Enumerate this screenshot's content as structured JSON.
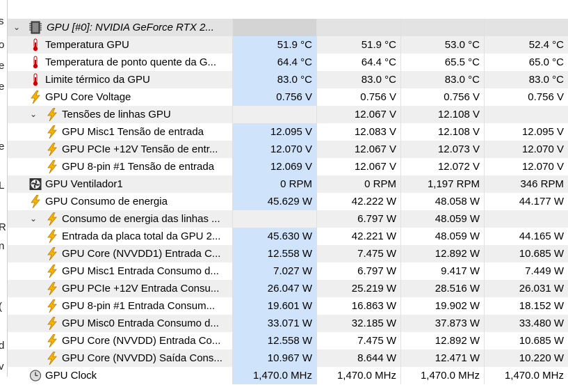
{
  "left_strip": [
    "s",
    "o",
    "e",
    "e",
    "",
    "e",
    "",
    "L",
    "R",
    "n",
    "(",
    "d",
    "v"
  ],
  "header_group": {
    "label": "GPU [#0]: NVIDIA GeForce RTX 2...",
    "icon": "gpu-chip-icon",
    "expand": "⌄"
  },
  "colors": {
    "highlight_column": "#cfe3fa",
    "group_row": "#e3e3e3",
    "alt_row": "#efefef"
  },
  "rows": [
    {
      "label": "Temperatura GPU",
      "icon": "thermometer-icon",
      "v1": "51.9 °C",
      "v2": "51.9 °C",
      "v3": "53.0 °C",
      "v4": "52.4 °C"
    },
    {
      "label": "Temperatura de ponto quente da G...",
      "icon": "thermometer-icon",
      "v1": "64.4 °C",
      "v2": "64.4 °C",
      "v3": "65.5 °C",
      "v4": "65.0 °C"
    },
    {
      "label": "Limite térmico da GPU",
      "icon": "thermometer-icon",
      "v1": "83.0 °C",
      "v2": "83.0 °C",
      "v3": "83.0 °C",
      "v4": "83.0 °C"
    },
    {
      "label": "GPU Core Voltage",
      "icon": "lightning-icon",
      "v1": "0.756 V",
      "v2": "0.756 V",
      "v3": "0.756 V",
      "v4": "0.756 V"
    },
    {
      "label": "Tensões de linhas GPU",
      "icon": "lightning-icon",
      "expand": "⌄",
      "v1": "",
      "v2": "12.067 V",
      "v3": "12.108 V",
      "v4": ""
    },
    {
      "label": "GPU Misc1 Tensão de entrada",
      "icon": "lightning-icon",
      "v1": "12.095 V",
      "v2": "12.083 V",
      "v3": "12.108 V",
      "v4": "12.095 V"
    },
    {
      "label": "GPU PCIe +12V Tensão de entr...",
      "icon": "lightning-icon",
      "v1": "12.070 V",
      "v2": "12.067 V",
      "v3": "12.073 V",
      "v4": "12.070 V"
    },
    {
      "label": "GPU 8-pin #1 Tensão de entrada",
      "icon": "lightning-icon",
      "v1": "12.069 V",
      "v2": "12.067 V",
      "v3": "12.072 V",
      "v4": "12.070 V"
    },
    {
      "label": "GPU Ventilador1",
      "icon": "fan-icon",
      "v1": "0 RPM",
      "v2": "0 RPM",
      "v3": "1,197 RPM",
      "v4": "346 RPM"
    },
    {
      "label": "GPU Consumo de energia",
      "icon": "lightning-icon",
      "v1": "45.629 W",
      "v2": "42.222 W",
      "v3": "48.058 W",
      "v4": "44.177 W"
    },
    {
      "label": "Consumo de energia das linhas ...",
      "icon": "lightning-icon",
      "expand": "⌄",
      "v1": "",
      "v2": "6.797 W",
      "v3": "48.059 W",
      "v4": ""
    },
    {
      "label": "Entrada da placa total da GPU 2...",
      "icon": "lightning-icon",
      "v1": "45.630 W",
      "v2": "42.221 W",
      "v3": "48.059 W",
      "v4": "44.165 W"
    },
    {
      "label": "GPU Core (NVVDD1) Entrada C...",
      "icon": "lightning-icon",
      "v1": "12.558 W",
      "v2": "7.475 W",
      "v3": "12.892 W",
      "v4": "10.685 W"
    },
    {
      "label": "GPU Misc1 Entrada Consumo d...",
      "icon": "lightning-icon",
      "v1": "7.027 W",
      "v2": "6.797 W",
      "v3": "9.417 W",
      "v4": "7.449 W"
    },
    {
      "label": "GPU PCIe +12V Entrada Consu...",
      "icon": "lightning-icon",
      "v1": "26.047 W",
      "v2": "25.219 W",
      "v3": "28.516 W",
      "v4": "26.031 W"
    },
    {
      "label": "GPU 8-pin #1 Entrada Consum...",
      "icon": "lightning-icon",
      "v1": "19.601 W",
      "v2": "16.863 W",
      "v3": "19.902 W",
      "v4": "18.152 W"
    },
    {
      "label": "GPU Misc0 Entrada Consumo d...",
      "icon": "lightning-icon",
      "v1": "33.071 W",
      "v2": "32.185 W",
      "v3": "37.873 W",
      "v4": "33.480 W"
    },
    {
      "label": "GPU Core (NVVDD) Entrada Co...",
      "icon": "lightning-icon",
      "v1": "12.558 W",
      "v2": "7.475 W",
      "v3": "12.892 W",
      "v4": "10.685 W"
    },
    {
      "label": "GPU Core (NVVDD) Saída Cons...",
      "icon": "lightning-icon",
      "v1": "10.967 W",
      "v2": "8.644 W",
      "v3": "12.471 W",
      "v4": "10.220 W"
    },
    {
      "label": "GPU Clock",
      "icon": "clock-icon",
      "v1": "1,470.0 MHz",
      "v2": "1,470.0 MHz",
      "v3": "1,470.0 MHz",
      "v4": "1,470.0 MHz"
    }
  ]
}
